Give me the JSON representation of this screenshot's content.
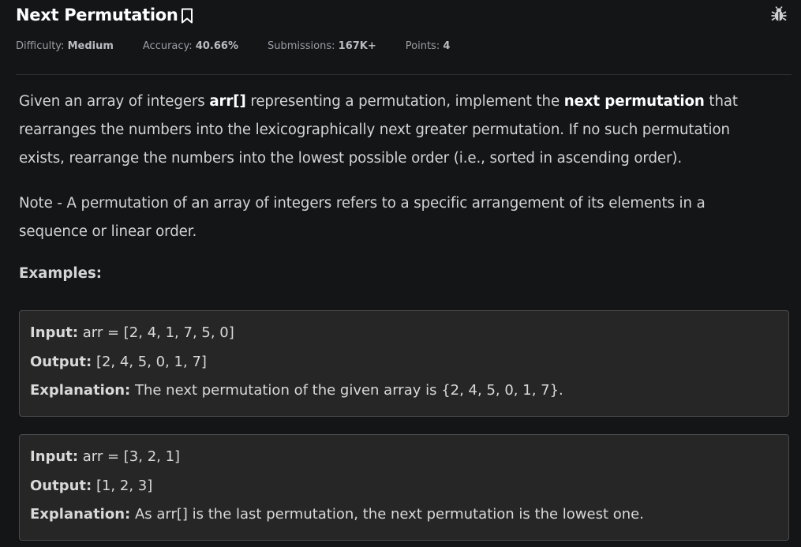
{
  "problem": {
    "title": "Next Permutation",
    "meta": {
      "difficulty_label": "Difficulty:",
      "difficulty": "Medium",
      "accuracy_label": "Accuracy:",
      "accuracy": "40.66%",
      "submissions_label": "Submissions:",
      "submissions": "167K+",
      "points_label": "Points:",
      "points": "4"
    },
    "description": {
      "p1_a": "Given an array of integers ",
      "p1_b": "arr[]",
      "p1_c": " representing a permutation, implement the ",
      "p1_d": "next permutation",
      "p1_e": " that rearranges the numbers into the lexicographically next greater permutation. If no such permutation exists, rearrange the numbers into the lowest possible order (i.e., sorted in ascending order).",
      "p2": "Note - A permutation of an array of integers refers to a specific arrangement of its elements in a sequence or linear order."
    },
    "examples_heading": "Examples:",
    "examples": [
      {
        "input_label": "Input:",
        "input": " arr = [2, 4, 1, 7, 5, 0]",
        "output_label": "Output:",
        "output": " [2, 4, 5, 0, 1, 7]",
        "explanation_label": "Explanation:",
        "explanation": " The next permutation of the given array is {2, 4, 5, 0, 1, 7}."
      },
      {
        "input_label": "Input:",
        "input": " arr = [3, 2, 1]",
        "output_label": "Output:",
        "output": " [1, 2, 3]",
        "explanation_label": "Explanation:",
        "explanation": " As arr[] is the last permutation, the next permutation is the lowest one."
      }
    ]
  },
  "icons": {
    "bookmark": "bookmark-icon",
    "bug": "bug-icon"
  },
  "colors": {
    "background": "#131517",
    "example_background": "#262626",
    "example_border": "#4a4a4a",
    "title": "#ffffff",
    "text": "#d4d4d4",
    "meta": "#9a9ea3"
  }
}
